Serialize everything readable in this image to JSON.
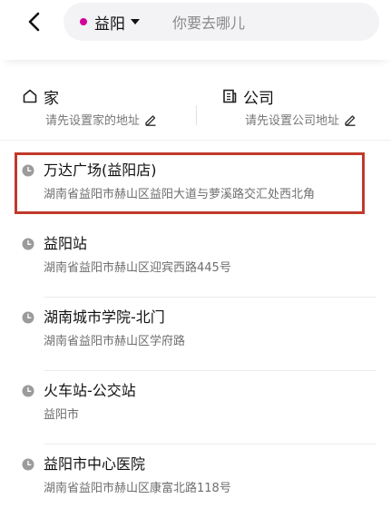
{
  "header": {
    "city": "益阳",
    "search_placeholder": "你要去哪儿",
    "accent_color": "#d4009b"
  },
  "shortcuts": {
    "home": {
      "title": "家",
      "subtitle": "请先设置家的地址",
      "icon": "house-icon"
    },
    "work": {
      "title": "公司",
      "subtitle": "请先设置公司地址",
      "icon": "building-icon"
    }
  },
  "history": [
    {
      "name": "万达广场(益阳店)",
      "address": "湖南省益阳市赫山区益阳大道与萝溪路交汇处西北角",
      "highlighted": true
    },
    {
      "name": "益阳站",
      "address": "湖南省益阳市赫山区迎宾西路445号"
    },
    {
      "name": "湖南城市学院-北门",
      "address": "湖南省益阳市赫山区学府路"
    },
    {
      "name": "火车站-公交站",
      "address": "益阳市"
    },
    {
      "name": "益阳市中心医院",
      "address": "湖南省益阳市赫山区康富北路118号"
    }
  ],
  "highlight_color": "#c0392b"
}
